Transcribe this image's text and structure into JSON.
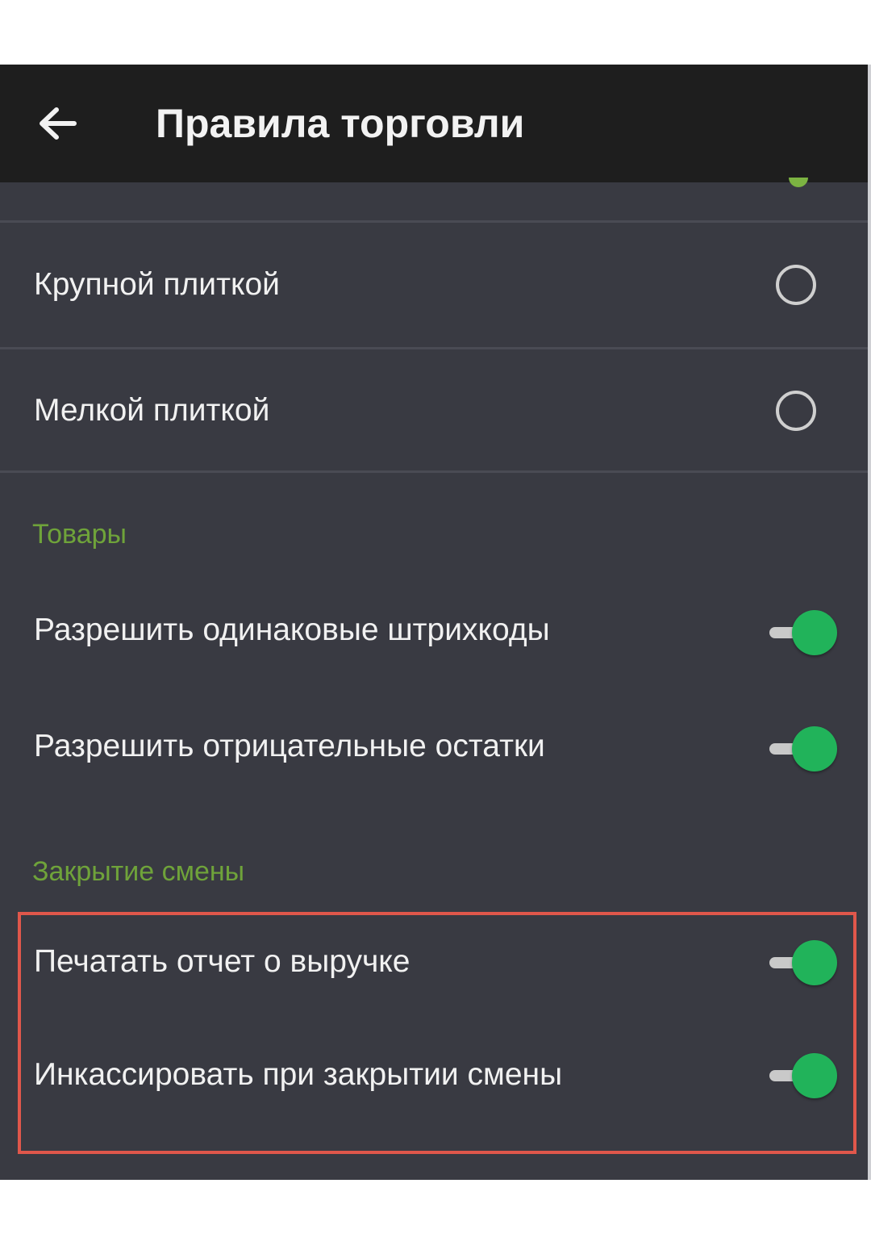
{
  "app_bar": {
    "title": "Правила торговли",
    "back_icon": "arrow-left-icon"
  },
  "display_options": [
    {
      "label": "Крупной плиткой",
      "selected": false
    },
    {
      "label": "Мелкой плиткой",
      "selected": false
    }
  ],
  "sections": {
    "goods": {
      "header": "Товары",
      "items": [
        {
          "label": "Разрешить одинаковые штрихкоды",
          "enabled": true
        },
        {
          "label": "Разрешить отрицательные остатки",
          "enabled": true
        }
      ]
    },
    "shift_close": {
      "header": "Закрытие смены",
      "items": [
        {
          "label": "Печатать отчет о выручке",
          "enabled": true
        },
        {
          "label": "Инкассировать при закрытии смены",
          "enabled": true
        }
      ]
    }
  },
  "colors": {
    "background": "#393a42",
    "app_bar": "#1e1e1e",
    "accent_green": "#21b35a",
    "section_header": "#6fa33a",
    "highlight_border": "#e0574b"
  }
}
